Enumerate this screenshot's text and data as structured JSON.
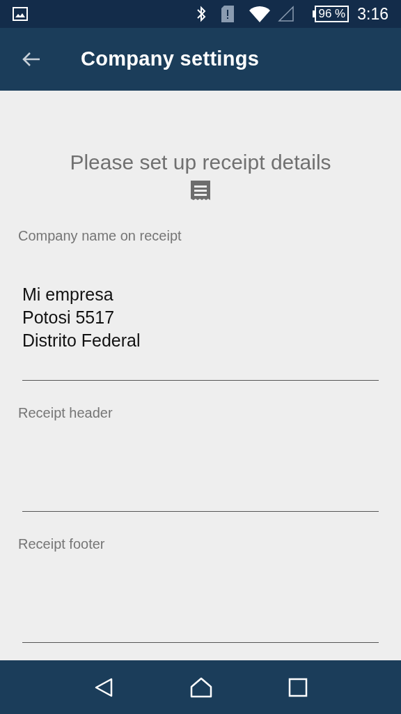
{
  "status_bar": {
    "battery": "96 %",
    "time": "3:16"
  },
  "app_bar": {
    "title": "Company settings"
  },
  "heading": "Please set up receipt details",
  "fields": [
    {
      "label": "Company name on receipt",
      "value": "Mi empresa\nPotosi 5517\nDistrito Federal"
    },
    {
      "label": "Receipt header"
    },
    {
      "label": "Receipt footer"
    }
  ]
}
